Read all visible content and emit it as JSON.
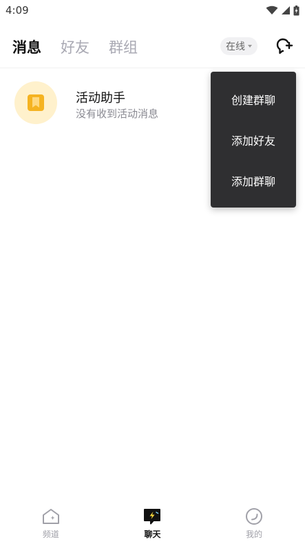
{
  "status_bar": {
    "time": "4:09"
  },
  "header": {
    "tabs": [
      {
        "label": "消息",
        "active": true
      },
      {
        "label": "好友",
        "active": false
      },
      {
        "label": "群组",
        "active": false
      }
    ],
    "status_label": "在线"
  },
  "conversations": [
    {
      "title": "活动助手",
      "subtitle": "没有收到活动消息",
      "icon": "bookmark-icon"
    }
  ],
  "menu": {
    "items": [
      "创建群聊",
      "添加好友",
      "添加群聊"
    ]
  },
  "bottom_nav": {
    "items": [
      {
        "label": "频道",
        "icon": "home-channel-icon",
        "active": false
      },
      {
        "label": "聊天",
        "icon": "chat-bolt-icon",
        "active": true
      },
      {
        "label": "我的",
        "icon": "profile-circle-icon",
        "active": false
      }
    ]
  },
  "colors": {
    "accent_yellow": "#f5b321",
    "menu_bg": "#2f2f31",
    "inactive_tab": "#a9a9b3"
  }
}
